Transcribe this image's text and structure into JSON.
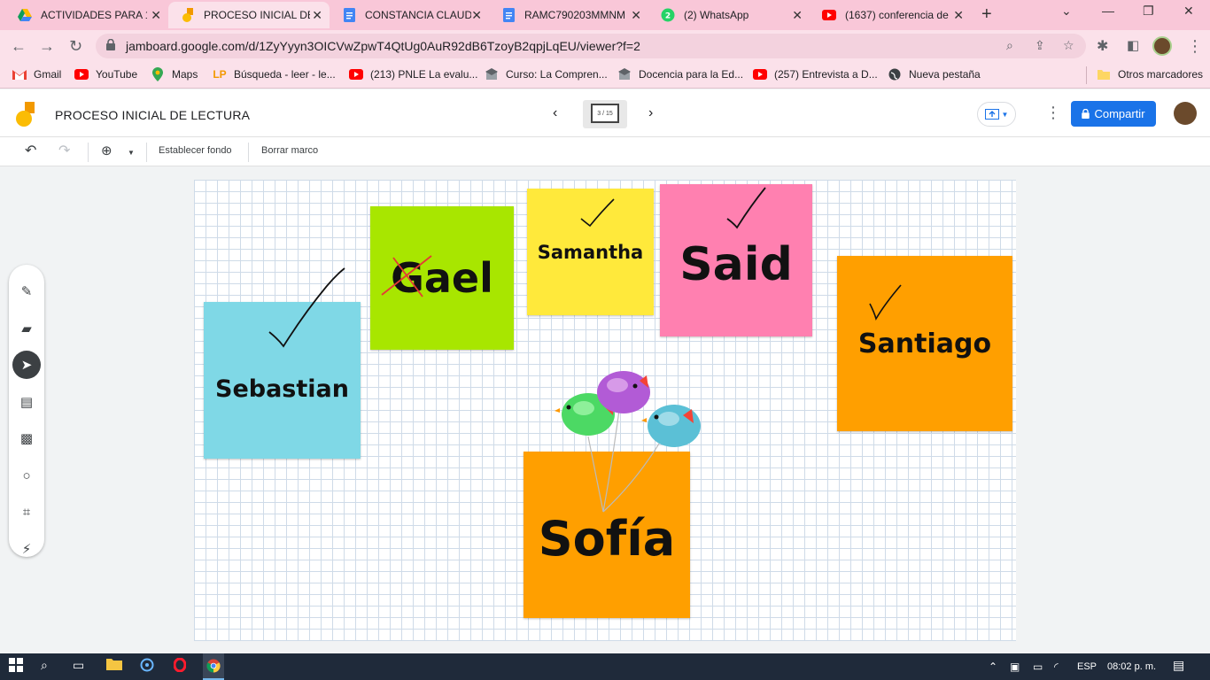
{
  "browser": {
    "tabs": [
      {
        "label": "ACTIVIDADES PARA 1°",
        "icon": "google-drive-icon",
        "active": false
      },
      {
        "label": "PROCESO INICIAL DE L",
        "icon": "jamboard-icon",
        "active": true
      },
      {
        "label": "CONSTANCIA CLAUDI",
        "icon": "google-docs-icon",
        "active": false
      },
      {
        "label": "RAMC790203MMNM",
        "icon": "google-docs-icon",
        "active": false
      },
      {
        "label": "(2) WhatsApp",
        "icon": "whatsapp-icon",
        "active": false
      },
      {
        "label": "(1637) conferencia de",
        "icon": "youtube-icon",
        "active": false
      }
    ],
    "url": "jamboard.google.com/d/1ZyYyyn3OICVwZpwT4QtUg0AuR92dB6TzoyB2qpjLqEU/viewer?f=2",
    "bookmarks": [
      {
        "label": "Gmail",
        "icon": "gmail-icon"
      },
      {
        "label": "YouTube",
        "icon": "youtube-icon"
      },
      {
        "label": "Maps",
        "icon": "maps-icon"
      },
      {
        "label": "Búsqueda - leer - le...",
        "icon": "lp-icon"
      },
      {
        "label": "(213) PNLE La evalu...",
        "icon": "youtube-icon"
      },
      {
        "label": "Curso: La Compren...",
        "icon": "course-icon"
      },
      {
        "label": "Docencia para la Ed...",
        "icon": "course-icon"
      },
      {
        "label": "(257) Entrevista a D...",
        "icon": "youtube-icon"
      },
      {
        "label": "Nueva pestaña",
        "icon": "globe-icon"
      }
    ],
    "other_bookmarks": "Otros marcadores"
  },
  "jamboard": {
    "title": "PROCESO INICIAL DE LECTURA",
    "frame_indicator": "3 / 15",
    "share_label": "Compartir",
    "toolbar": {
      "set_background": "Establecer fondo",
      "clear_frame": "Borrar marco"
    }
  },
  "notes": {
    "sebastian": "Sebastian",
    "gael": "Gael",
    "samantha": "Samantha",
    "said": "Said",
    "santiago": "Santiago",
    "sofia": "Sofía"
  },
  "colors": {
    "cyan": "#7fd8e6",
    "green": "#a8e600",
    "yellow": "#ffe93b",
    "pink": "#ff80b0",
    "orange": "#ff9f00"
  },
  "taskbar": {
    "language": "ESP",
    "time": "08:02 p. m."
  }
}
